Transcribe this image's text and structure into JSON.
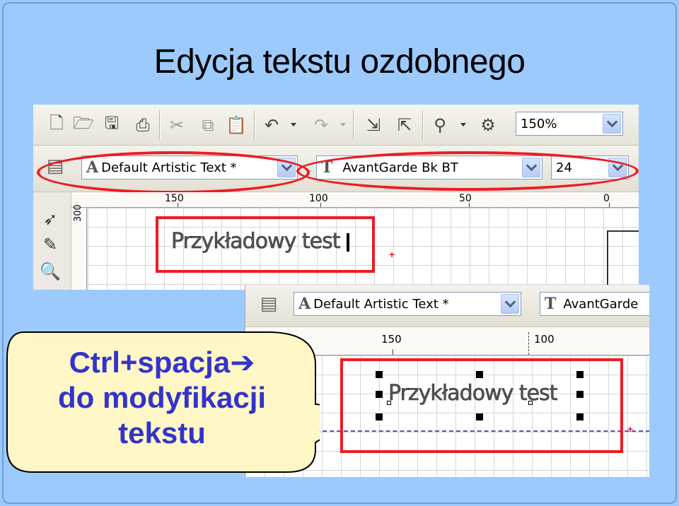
{
  "slide": {
    "title": "Edycja tekstu ozdobnego"
  },
  "toolbar": {
    "zoom_value": "150%",
    "icons": [
      "new-file-icon",
      "open-file-icon",
      "save-icon",
      "print-icon",
      "cut-icon",
      "copy-icon",
      "paste-icon",
      "undo-icon",
      "redo-icon",
      "import-icon",
      "export-icon",
      "launcher-icon",
      "snap-icon"
    ]
  },
  "property_bar": {
    "style_value": "Default Artistic Text *",
    "font_value": "AvantGarde Bk BT",
    "size_value": "24",
    "font_glyph": "T"
  },
  "ruler": {
    "labels": [
      "150",
      "100",
      "50",
      "0"
    ],
    "vertical_label": "300"
  },
  "canvas": {
    "text": "Przykładowy test"
  },
  "second_view": {
    "style_value": "Default Artistic Text *",
    "font_value": "AvantGarde",
    "ruler_labels": [
      "150",
      "100"
    ],
    "text": "Przykładowy test"
  },
  "callout": {
    "line1": "Ctrl+spacja",
    "arrow": "➔",
    "line2": "do modyfikacji",
    "line3": "tekstu"
  },
  "colors": {
    "background": "#9ccafc",
    "highlight": "#ec1c24",
    "callout_text": "#3333cc",
    "callout_fill": "#fff7c6"
  }
}
